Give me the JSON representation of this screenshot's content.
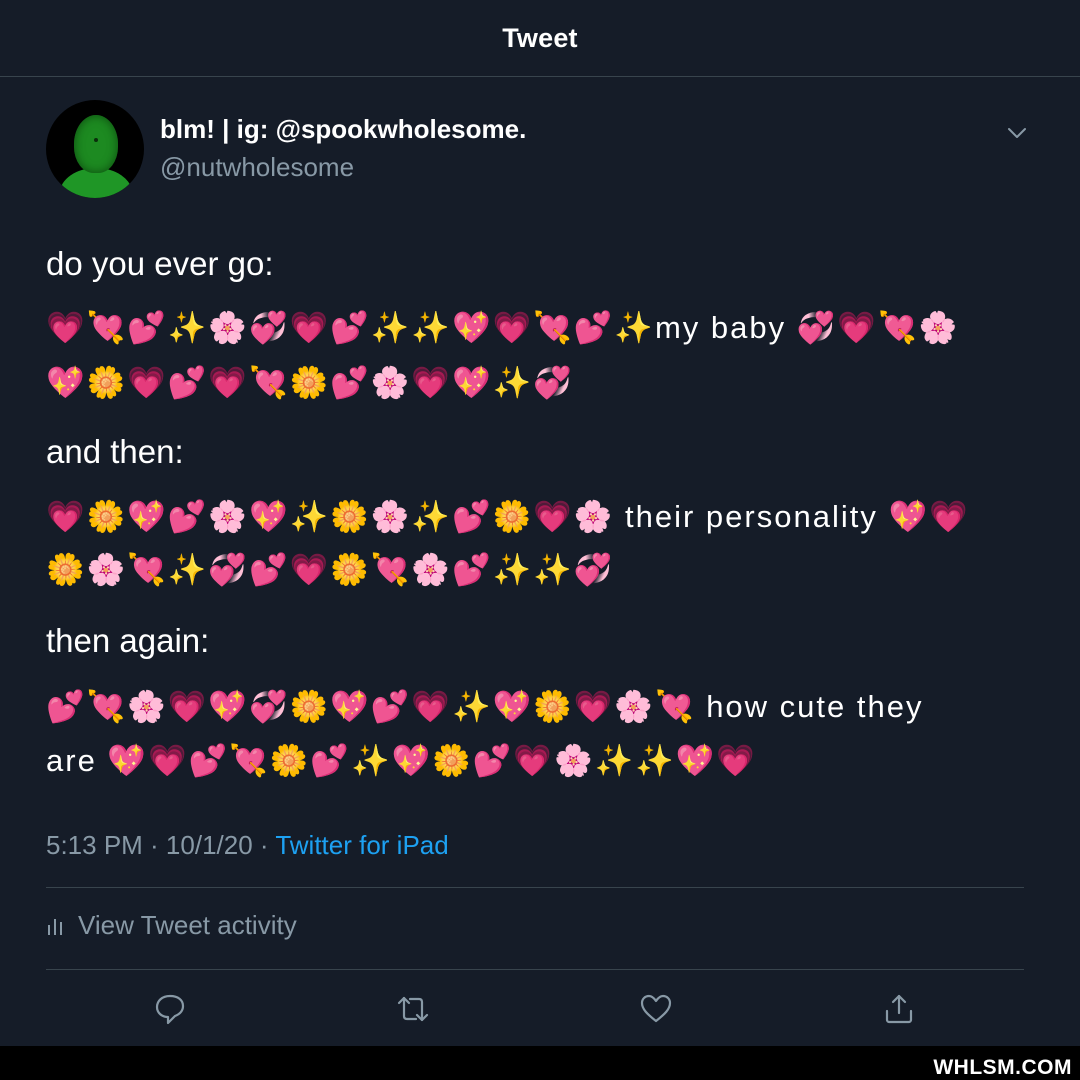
{
  "header": {
    "title": "Tweet"
  },
  "author": {
    "display_name": "blm! | ig: @spookwholesome.",
    "handle": "@nutwholesome"
  },
  "tweet": {
    "line1": "do you ever go:",
    "emoji1a": "💗💘💕✨🌸💞💗💕✨✨💖💗💘💕✨my baby 💞💗💘🌸",
    "emoji1b": "💖🌼💗💕💗💘🌼💕🌸💗💖✨💞",
    "line2": "and then:",
    "emoji2a": "💗🌼💖💕🌸💖✨🌼🌸✨💕🌼💗🌸 their personality 💖💗",
    "emoji2b": "🌼🌸💘✨💞💕💗🌼💘🌸💕✨✨💞",
    "line3": "then again:",
    "emoji3a": "💕💘🌸💗💖💞🌼💖💕💗✨💖🌼💗🌸💘 how cute they",
    "emoji3b": "are 💖💗💕💘🌼💕✨💖🌼💕💗🌸✨✨💖💗"
  },
  "meta": {
    "time_date": "5:13 PM · 10/1/20 · ",
    "source": "Twitter for iPad"
  },
  "activity": {
    "label": "View Tweet activity"
  },
  "actions": {
    "reply_icon": "reply-icon",
    "retweet_icon": "retweet-icon",
    "like_icon": "heart-icon",
    "share_icon": "share-icon"
  },
  "watermark": "WHLSM.COM",
  "colors": {
    "background": "#151c28",
    "muted": "#8899a6",
    "link": "#1da1f2",
    "divider": "#38444d"
  }
}
